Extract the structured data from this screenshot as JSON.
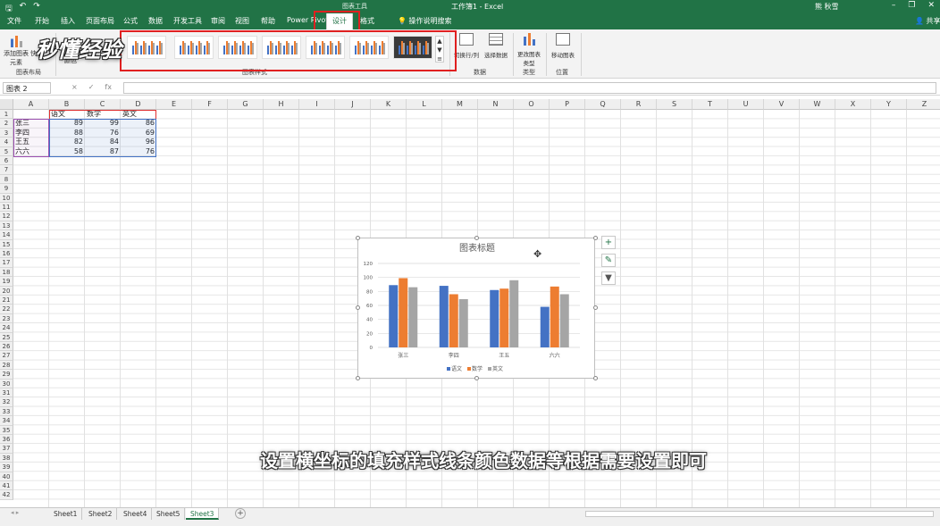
{
  "titlebar": {
    "context_tools": "图表工具",
    "document": "工作簿1 - Excel",
    "user": "熊 秋雪",
    "qat": [
      "save-icon",
      "undo-icon",
      "redo-icon"
    ]
  },
  "tabs": [
    "文件",
    "开始",
    "插入",
    "页面布局",
    "公式",
    "数据",
    "开发工具",
    "审阅",
    "视图",
    "帮助",
    "Power Pivot",
    "设计",
    "格式",
    "操作说明搜索"
  ],
  "share": "共享",
  "ribbon": {
    "add_element": "添加图表元素",
    "quick_layout": "快",
    "colors": "颜色",
    "group_layout": "图表布局",
    "group_styles": "图表样式",
    "switch_row_col": "切换行/列",
    "select_data": "选择数据",
    "group_data": "数据",
    "change_type": "更改图表类型",
    "group_type": "类型",
    "move_chart": "移动图表",
    "group_location": "位置"
  },
  "watermark": "秒懂经验",
  "namebox": "图表 2",
  "fx_icons": [
    "×",
    "✓",
    "fx"
  ],
  "columns": [
    "A",
    "B",
    "C",
    "D",
    "E",
    "F",
    "G",
    "H",
    "I",
    "J",
    "K",
    "L",
    "M",
    "N",
    "O",
    "P",
    "Q",
    "R",
    "S",
    "T",
    "U",
    "V",
    "W",
    "X",
    "Y",
    "Z"
  ],
  "row_count": 42,
  "table": {
    "headers": [
      "语文",
      "数学",
      "英文"
    ],
    "rows": [
      {
        "name": "张三",
        "v": [
          89,
          99,
          86
        ]
      },
      {
        "name": "李四",
        "v": [
          88,
          76,
          69
        ]
      },
      {
        "name": "王五",
        "v": [
          82,
          84,
          96
        ]
      },
      {
        "name": "六六",
        "v": [
          58,
          87,
          76
        ]
      }
    ]
  },
  "chart_data": {
    "type": "bar",
    "title": "图表标题",
    "categories": [
      "张三",
      "李四",
      "王五",
      "六六"
    ],
    "series": [
      {
        "name": "语文",
        "values": [
          89,
          88,
          82,
          58
        ],
        "color": "#4472c4"
      },
      {
        "name": "数学",
        "values": [
          99,
          76,
          84,
          87
        ],
        "color": "#ed7d31"
      },
      {
        "name": "英文",
        "values": [
          86,
          69,
          96,
          76
        ],
        "color": "#a5a5a5"
      }
    ],
    "ylim": [
      0,
      120
    ],
    "yticks": [
      0,
      20,
      40,
      60,
      80,
      100,
      120
    ],
    "grid": true,
    "legend": "bottom"
  },
  "subtitle": "设置横坐标的填充样式线条颜色数据等根据需要设置即可",
  "sheets": [
    "Sheet1",
    "Sheet2",
    "Sheet4",
    "Sheet5",
    "Sheet3"
  ],
  "active_sheet": "Sheet3",
  "colors": {
    "excel_green": "#217346",
    "highlight_red": "#e02020"
  }
}
